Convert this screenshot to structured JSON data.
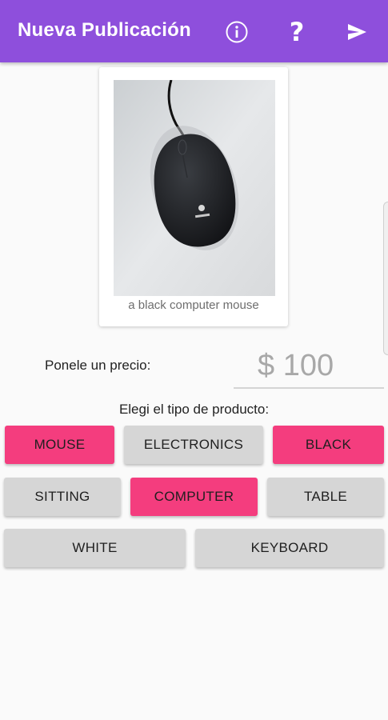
{
  "appbar": {
    "title": "Nueva Publicación",
    "actions": {
      "info": "info-icon",
      "help": "?",
      "send": "send-icon"
    },
    "color": "#8e4fdc"
  },
  "photo": {
    "caption": "a black computer mouse"
  },
  "price": {
    "label": "Ponele un precio:",
    "value": "$ 100"
  },
  "product_type": {
    "label": "Elegi el tipo de producto:",
    "selected_color": "#f43d7e",
    "unselected_color": "#d6d6d6",
    "tags": [
      {
        "label": "MOUSE",
        "selected": true
      },
      {
        "label": "ELECTRONICS",
        "selected": false
      },
      {
        "label": "BLACK",
        "selected": true
      },
      {
        "label": "SITTING",
        "selected": false
      },
      {
        "label": "COMPUTER",
        "selected": true
      },
      {
        "label": "TABLE",
        "selected": false
      },
      {
        "label": "WHITE",
        "selected": false
      },
      {
        "label": "KEYBOARD",
        "selected": false
      }
    ]
  }
}
